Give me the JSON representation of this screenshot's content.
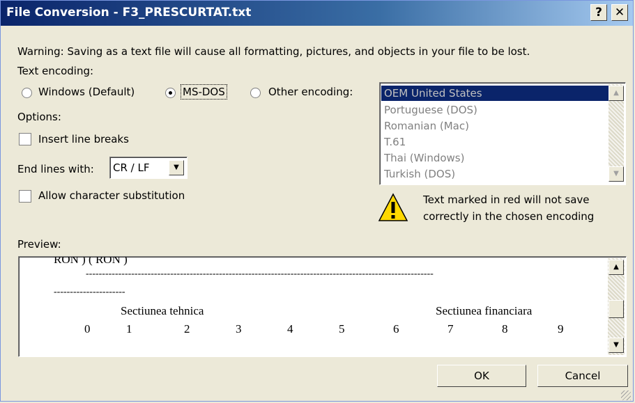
{
  "window": {
    "title": "File Conversion - F3_PRESCURTAT.txt",
    "help_label": "?",
    "close_label": "✕"
  },
  "warning_text": "Warning: Saving as a text file will cause all formatting, pictures, and objects in your file to be lost.",
  "encoding": {
    "label": "Text encoding:",
    "options": [
      "Windows (Default)",
      "MS-DOS",
      "Other encoding:"
    ],
    "selected": "MS-DOS",
    "list_items": [
      "OEM United States",
      "Portuguese (DOS)",
      "Romanian (Mac)",
      "T.61",
      "Thai (Windows)",
      "Turkish (DOS)"
    ],
    "list_selected": "OEM United States"
  },
  "options": {
    "label": "Options:",
    "insert_line_breaks": "Insert line breaks",
    "end_lines_label": "End lines with:",
    "end_lines_value": "CR / LF",
    "allow_substitution": "Allow character substitution"
  },
  "note": {
    "line1": "Text marked in red will not save",
    "line2": "correctly in the chosen encoding"
  },
  "preview": {
    "label": "Preview:",
    "line1": "RON )   ( RON )",
    "dashes1": "-----------------------------------------------------------------------------------------------------------",
    "dashes2": "----------------------",
    "tech": "Sectiunea tehnica",
    "fin": "Sectiunea financiara",
    "numbers": [
      "0",
      "1",
      "2",
      "3",
      "4",
      "5",
      "6",
      "7",
      "8",
      "9"
    ]
  },
  "buttons": {
    "ok": "OK",
    "cancel": "Cancel"
  },
  "colors": {
    "title_bar_start": "#0a246a",
    "selection": "#0a246a",
    "dialog_bg": "#ece9d8"
  }
}
